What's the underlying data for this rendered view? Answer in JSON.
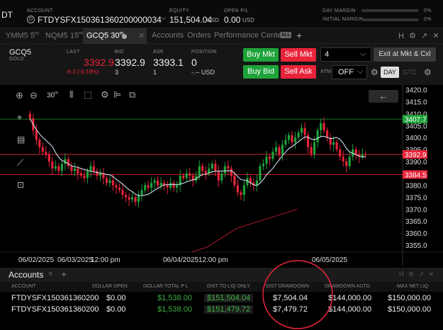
{
  "topbar": {
    "dt": "DT",
    "account_label": "ACCOUNT",
    "account_value": "FTDYSFX150361360200000034",
    "equity_label": "EQUITY",
    "equity_value": "151,504.04",
    "equity_unit": "USD",
    "openpl_label": "OPEN P/L",
    "openpl_value": "0.00",
    "openpl_unit": "USD",
    "day_margin_label": "DAY MARGIN",
    "day_margin_pct": "0%",
    "initial_margin_label": "INITIAL MARGIN",
    "initial_margin_pct": "0%"
  },
  "tabs": [
    {
      "label": "YMM5 5",
      "sup": "m"
    },
    {
      "label": "NQM5 15",
      "sup": "m"
    },
    {
      "label": "GCQ5 30",
      "sup": "m"
    },
    {
      "label": "Accounts"
    },
    {
      "label": "Orders"
    },
    {
      "label": "Performance Center"
    }
  ],
  "tab_badge": "ALL",
  "tab_add": "+",
  "tab_right_icons": "H ⚙ ↗ ✕",
  "quote": {
    "symbol": "GCQ5",
    "name": "GOLD",
    "last_label": "LAST",
    "last": "3392.9",
    "change": "-6.3 (-0.19%)",
    "bid_label": "BID",
    "bid": "3392.9",
    "bid_size": "3",
    "ask_label": "ASK",
    "ask": "3393.1",
    "ask_size": "1",
    "position_label": "POSITION",
    "position": "0",
    "position_value": "-.-- USD",
    "buy_mkt": "Buy Mkt",
    "sell_mkt": "Sell Mkt",
    "buy_bid": "Buy Bid",
    "sell_ask": "Sell Ask",
    "qty": "4",
    "exit_label": "Exit at Mkt & Cxl",
    "atm_label": "ATM",
    "atm_value": "OFF",
    "day": "DAY",
    "gtc": "GTC"
  },
  "chart_toolbar": {
    "interval": "30",
    "interval_sup": "m"
  },
  "chart_data": {
    "type": "candlestick",
    "ylim": [
      3352,
      3422
    ],
    "y_ticks": [
      "3420.0",
      "3415.0",
      "3410.0",
      "3405.0",
      "3400.0",
      "3395.0",
      "3390.0",
      "3385.0",
      "3380.0",
      "3375.0",
      "3370.0",
      "3365.0",
      "3360.0",
      "3355.0"
    ],
    "price_markers": [
      {
        "label": "3407.7",
        "value": 3407.7,
        "color": "#1fa33a"
      },
      {
        "label": "3392.9",
        "value": 3392.9,
        "color": "#e8243a"
      },
      {
        "label": "3384.5",
        "value": 3384.5,
        "color": "#e8243a"
      }
    ],
    "x_labels": [
      "06/02/2025",
      "06/03/2025",
      "12:00 pm",
      "06/04/2025",
      "12:00 pm",
      "06/05/2025"
    ],
    "closes": [
      3408,
      3403,
      3399,
      3396,
      3394,
      3393,
      3390,
      3387,
      3388,
      3386,
      3389,
      3391,
      3388,
      3386,
      3387,
      3385,
      3384,
      3383,
      3386,
      3388,
      3386,
      3384,
      3385,
      3383,
      3381,
      3382,
      3380,
      3379,
      3378,
      3376,
      3375,
      3374,
      3375,
      3373,
      3376,
      3378,
      3380,
      3379,
      3381,
      3382,
      3380,
      3381,
      3380,
      3379,
      3381,
      3379,
      3380,
      3384,
      3383,
      3385,
      3384,
      3382,
      3384,
      3388,
      3386,
      3385,
      3387,
      3389,
      3386,
      3382,
      3385,
      3388,
      3387,
      3384,
      3380,
      3377,
      3376,
      3380,
      3383,
      3381,
      3380,
      3382,
      3388,
      3389,
      3392,
      3391,
      3394,
      3396,
      3393,
      3397,
      3399,
      3401,
      3398,
      3400,
      3402,
      3404,
      3401,
      3396,
      3393,
      3398,
      3403,
      3406,
      3403,
      3400,
      3397,
      3398,
      3395,
      3392,
      3390,
      3388,
      3392,
      3395,
      3393,
      3392,
      3393,
      3392.9
    ],
    "volume_line": [
      3352,
      3353,
      3354,
      3356,
      3358,
      3360,
      3362,
      3363,
      3364,
      3365,
      3366,
      3367,
      3368,
      3369,
      3370
    ]
  },
  "accounts": {
    "title": "Accounts",
    "close": "×",
    "add": "+",
    "right_icons": "H ⚙ ↗ ✕",
    "columns": [
      "ACCOUNT",
      "DOLLAR OPEN",
      "DOLLAR TOTAL P L",
      "DIST TO LIQ ONLY",
      "DIST DRAWDOWN",
      "DRAWDOWN AUTO",
      "MAX NET LIQ"
    ],
    "rows": [
      [
        "FTDYSFX150361360200",
        "$0.00",
        "$1,538.00",
        "$151,504.04",
        "$7,504.04",
        "$144,000.00",
        "$150,000.00"
      ],
      [
        "FTDYSFX150361360200",
        "$0.00",
        "$1,538.00",
        "$151,479.72",
        "$7,479.72",
        "$144,000.00",
        "$150,000.00"
      ]
    ]
  },
  "colors": {
    "up": "#1fa33a",
    "down": "#e8243a",
    "ma": "#d9f0ff",
    "annotation": "#e8243a"
  }
}
